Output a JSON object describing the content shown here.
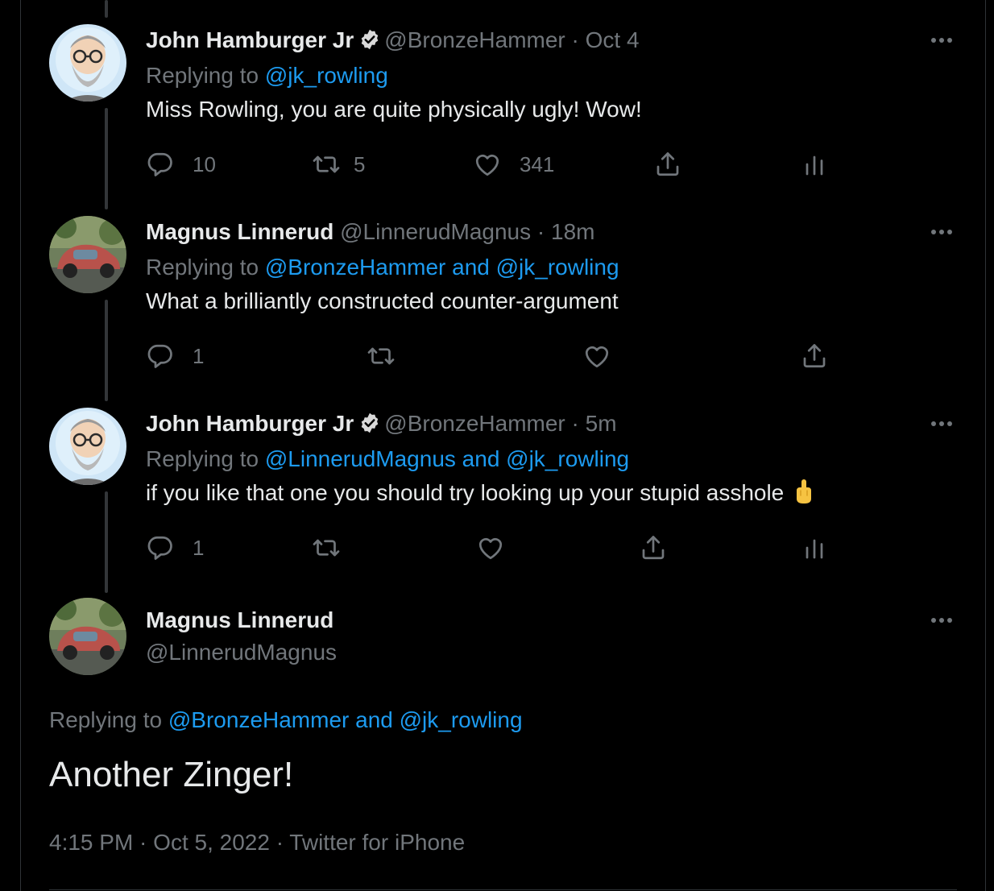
{
  "tweets": [
    {
      "display_name": "John Hamburger Jr",
      "handle": "@BronzeHammer",
      "time": "Oct 4",
      "replying_label": "Replying to",
      "mentions": "@jk_rowling",
      "text": "Miss Rowling, you are quite physically ugly! Wow!",
      "reply_count": "10",
      "retweet_count": "5",
      "like_count": "341"
    },
    {
      "display_name": "Magnus Linnerud",
      "handle": "@LinnerudMagnus",
      "time": "18m",
      "replying_label": "Replying to",
      "mentions": "@BronzeHammer and @jk_rowling",
      "text": "What a brilliantly constructed counter-argument",
      "reply_count": "1",
      "retweet_count": "",
      "like_count": ""
    },
    {
      "display_name": "John Hamburger Jr",
      "handle": "@BronzeHammer",
      "time": "5m",
      "replying_label": "Replying to",
      "mentions": "@LinnerudMagnus and @jk_rowling",
      "text": "if you like that one you should try looking up your stupid asshole",
      "emoji": "middle-finger-emoji",
      "reply_count": "1",
      "retweet_count": "",
      "like_count": ""
    }
  ],
  "main_tweet": {
    "display_name": "Magnus Linnerud",
    "handle": "@LinnerudMagnus",
    "replying_label": "Replying to",
    "mentions": "@BronzeHammer and @jk_rowling",
    "text": "Another Zinger!",
    "meta": "4:15 PM · Oct 5, 2022 · Twitter for iPhone"
  },
  "separator": "·",
  "colors": {
    "background": "#000000",
    "text": "#e7e9ea",
    "muted": "#71767b",
    "link": "#1d9bf0",
    "border": "#2f3336"
  }
}
